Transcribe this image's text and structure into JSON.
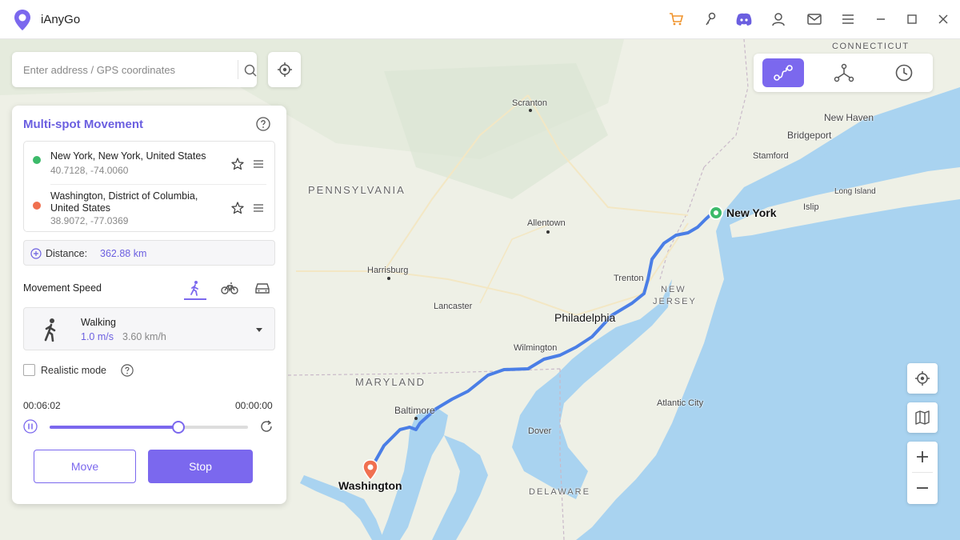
{
  "app": {
    "title": "iAnyGo"
  },
  "titlebar": {
    "icons": [
      "cart-icon",
      "key-icon",
      "discord-icon",
      "user-icon",
      "mail-icon",
      "menu-icon",
      "minimize-icon",
      "maximize-icon",
      "close-icon"
    ]
  },
  "search": {
    "placeholder": "Enter address / GPS coordinates"
  },
  "modes": [
    "multi-spot-mode-icon",
    "jump-teleport-mode-icon",
    "history-icon"
  ],
  "panel": {
    "title": "Multi-spot Movement",
    "spots": [
      {
        "name": "New York, New York, United States",
        "coords": "40.7128, -74.0060",
        "color": "#3cba6a"
      },
      {
        "name": "Washington, District of Columbia, United States",
        "coords": "38.9072, -77.0369",
        "color": "#f07050"
      }
    ],
    "distance_label": "Distance:",
    "distance_value": "362.88 km",
    "speed_label": "Movement Speed",
    "speed_tabs": [
      "walking-icon",
      "cycling-icon",
      "driving-icon"
    ],
    "selected_mode": "Walking",
    "speed_ms": "1.0 m/s",
    "speed_kmh": "3.60 km/h",
    "realistic_label": "Realistic mode",
    "realistic_checked": false,
    "time_elapsed": "00:06:02",
    "time_remaining": "00:00:00",
    "progress": 0.65,
    "move_label": "Move",
    "stop_label": "Stop"
  },
  "map": {
    "labels": {
      "connecticut": "CONNECTICUT",
      "scranton": "Scranton",
      "new_haven": "New Haven",
      "bridgeport": "Bridgeport",
      "stamford": "Stamford",
      "pennsylvania": "PENNSYLVANIA",
      "long_island": "Long Island",
      "new_york": "New York",
      "islip": "Islip",
      "allentown": "Allentown",
      "harrisburg": "Harrisburg",
      "trenton": "Trenton",
      "new_jersey_1": "NEW",
      "new_jersey_2": "JERSEY",
      "lancaster": "Lancaster",
      "philadelphia": "Philadelphia",
      "wilmington": "Wilmington",
      "maryland": "MARYLAND",
      "baltimore": "Baltimore",
      "atlantic_city": "Atlantic City",
      "dover": "Dover",
      "washington": "Washington",
      "delaware": "DELAWARE"
    },
    "route_color": "#4a7ee6",
    "water_color": "#a9d3f0"
  },
  "colors": {
    "accent": "#7b68ee",
    "accent_text": "#6b5fe0"
  }
}
